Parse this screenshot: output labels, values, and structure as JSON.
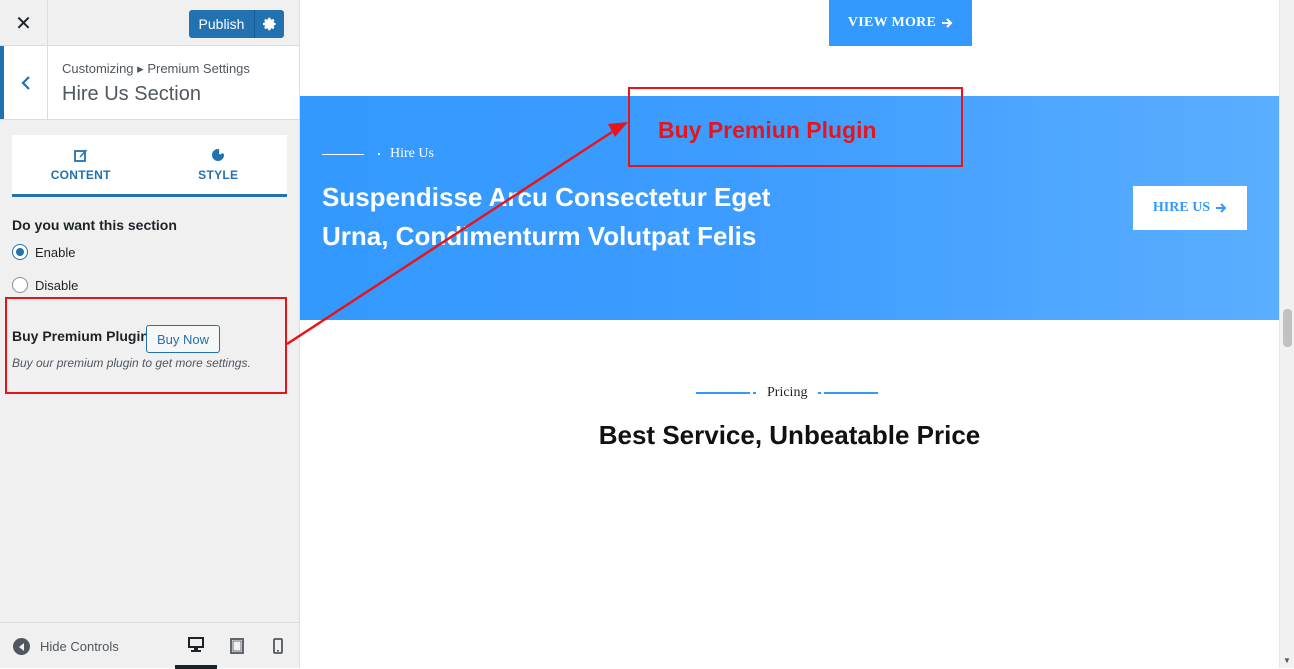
{
  "topbar": {
    "close_glyph": "✕",
    "publish_label": "Publish"
  },
  "section": {
    "breadcrumb_root": "Customizing",
    "breadcrumb_sep": "▸",
    "breadcrumb_parent": "Premium Settings",
    "title": "Hire Us Section"
  },
  "tabs": [
    {
      "label": "CONTENT",
      "icon": "edit-icon"
    },
    {
      "label": "STYLE",
      "icon": "palette-icon"
    }
  ],
  "form": {
    "question": "Do you want this section",
    "options": [
      {
        "label": "Enable",
        "checked": true
      },
      {
        "label": "Disable",
        "checked": false
      }
    ]
  },
  "premium": {
    "title": "Buy Premium Plugin",
    "button_label": "Buy Now",
    "description": "Buy our premium plugin to get more settings."
  },
  "footer": {
    "hide_controls": "Hide Controls",
    "devices": [
      "desktop-icon",
      "tablet-icon",
      "mobile-icon"
    ],
    "active_device": "desktop"
  },
  "preview": {
    "view_more": "VIEW MORE",
    "hire_kicker": "Hire Us",
    "hire_heading_line1": "Suspendisse Arcu Consectetur Eget",
    "hire_heading_line2": "Urna, Condimenturm Volutpat Felis",
    "hire_button": "HIRE US",
    "pricing_kicker": "Pricing",
    "pricing_title": "Best Service, Unbeatable Price"
  },
  "annotation": {
    "text": "Buy Premiun Plugin",
    "color": "#e8141b"
  },
  "colors": {
    "accent": "#2271b1",
    "brand_blue": "#3399ff"
  }
}
